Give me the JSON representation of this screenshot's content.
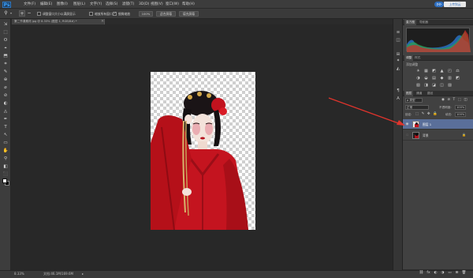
{
  "app": {
    "logo": "Ps"
  },
  "menu": {
    "items": [
      "文件(F)",
      "编辑(E)",
      "图像(I)",
      "图层(L)",
      "文字(Y)",
      "选择(S)",
      "滤镜(T)",
      "3D(D)",
      "视图(V)",
      "窗口(W)",
      "帮助(H)"
    ],
    "cloud_label": "ᐅᐅ",
    "share_label": "上传到云"
  },
  "options": {
    "zoom_in": "+",
    "zoom_out": "−",
    "resize_label": "调整窗口大小以满屏显示",
    "resize_checked": false,
    "zoom_all_label": "缩放所有窗口",
    "zoom_all_checked": false,
    "scrubby_label": "细微缩放",
    "scrubby_checked": true,
    "btn_100": "100%",
    "btn_fit": "适合屏幕",
    "btn_fill": "填充屏幕"
  },
  "document": {
    "tab_title": "第二节课素材.jpg @ 8.33% (图层 1, RGB/8#) *",
    "tab_close": "×"
  },
  "tools": [
    "⇲",
    "⬚",
    "ʘ",
    "⌖",
    "⬒",
    "⌗",
    "✎",
    "⊕",
    "⌀",
    "⊘",
    "◐",
    "◬",
    "✒",
    "T",
    "↖",
    "▭",
    "✋",
    "⚲",
    "◧",
    "⬛"
  ],
  "status": {
    "zoom": "8.33%",
    "doc_info": "文档:46.1M/169.6M",
    "arrow": "▸"
  },
  "panels": {
    "strip_icons": [
      "≡",
      "◫",
      "⊞",
      "✦",
      "◭",
      "¶",
      "A"
    ],
    "histogram_tabs": [
      "直方图",
      "导航器"
    ],
    "adjust_tabs": [
      "调整",
      "样式"
    ],
    "adjust_title": "添加调整",
    "adjust_icons": [
      "☀",
      "▦",
      "◩",
      "▲",
      "◰",
      "⚖",
      "◑",
      "◒",
      "▤",
      "◆",
      "▥",
      "◩",
      "▧",
      "◨",
      "◪",
      "◫",
      "▨"
    ],
    "layer_tabs": [
      "图层",
      "通道",
      "路径"
    ],
    "filter_label": "ρ 类型",
    "blend_mode": "正常",
    "opacity_label": "不透明度:",
    "opacity_value": "100%",
    "lock_label": "锁定:",
    "fill_label": "填充:",
    "fill_value": "100%",
    "layers": [
      {
        "name": "图层 1",
        "visible": true,
        "selected": true,
        "locked": false
      },
      {
        "name": "背景",
        "visible": false,
        "selected": false,
        "locked": true
      }
    ],
    "lock_icon": "🔒",
    "bottom_icons": [
      "⛓",
      "fx",
      "◐",
      "◑",
      "▭",
      "⊞",
      "🗑"
    ]
  },
  "annotation": {
    "color": "#e0342c"
  }
}
